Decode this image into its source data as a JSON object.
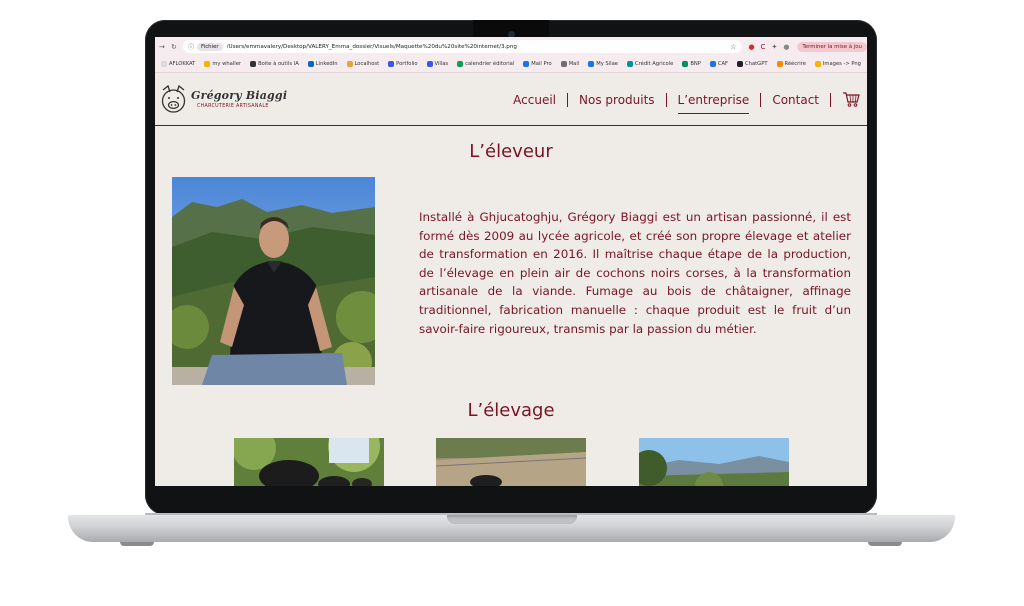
{
  "browser": {
    "file_chip": "Fichier",
    "url": "/Users/emmavalery/Desktop/VALERY_Emma_dossier/Visuels/Maquette%20du%20site%20internet/3.png",
    "update_button": "Terminer la mise à jou",
    "bookmarks": [
      {
        "label": "AFLOKKAT",
        "color": "#d9d9d9"
      },
      {
        "label": "my whaller",
        "color": "#f5b400"
      },
      {
        "label": "Boite à outils IA",
        "color": "#333333"
      },
      {
        "label": "LinkedIn",
        "color": "#0a66c2"
      },
      {
        "label": "Localhost",
        "color": "#e8a33d"
      },
      {
        "label": "Portfolio",
        "color": "#3858e9"
      },
      {
        "label": "Villas",
        "color": "#3858e9"
      },
      {
        "label": "calendrier éditorial",
        "color": "#0f9d58"
      },
      {
        "label": "Mail Pro",
        "color": "#1a73e8"
      },
      {
        "label": "Mail",
        "color": "#6e6e6e"
      },
      {
        "label": "My Silae",
        "color": "#1a73e8"
      },
      {
        "label": "Crédit Agricole",
        "color": "#009597"
      },
      {
        "label": "BNP",
        "color": "#00915a"
      },
      {
        "label": "CAF",
        "color": "#1a73e8"
      },
      {
        "label": "ChatGPT",
        "color": "#202123"
      },
      {
        "label": "Réécrire",
        "color": "#f08c00"
      },
      {
        "label": "Images -> Png",
        "color": "#f5b400"
      }
    ]
  },
  "site": {
    "brand_name": "Grégory Biaggi",
    "brand_tagline": "CHARCUTERIE ARTISANALE",
    "menu": [
      "Accueil",
      "Nos produits",
      "L’entreprise",
      "Contact"
    ],
    "active_menu": 2
  },
  "eleveur": {
    "title": "L’éleveur",
    "bio": "Installé à Ghjucatoghju, Grégory Biaggi est un artisan passionné, il est formé dès 2009 au lycée agricole, et créé son propre élevage et atelier de transformation en 2016. Il maîtrise chaque étape de la production, de l’élevage en plein air de cochons noirs corses, à la transformation artisanale de la viande. Fumage au bois de châtaigner, affinage traditionnel, fabrication manuelle : chaque produit est le fruit d’un savoir-faire rigoureux, transmis par la passion du métier."
  },
  "elevage": {
    "title": "L’élevage"
  },
  "colors": {
    "accent": "#7a1424",
    "page_bg": "#efece7"
  }
}
